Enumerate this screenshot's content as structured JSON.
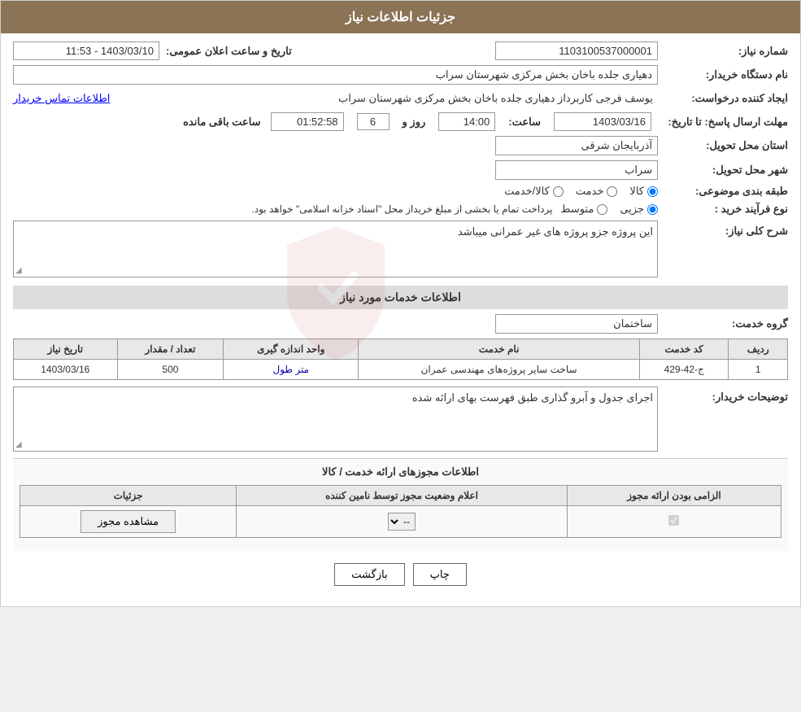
{
  "page": {
    "title": "جزئیات اطلاعات نیاز"
  },
  "header": {
    "need_number_label": "شماره نیاز:",
    "need_number_value": "1103100537000001",
    "date_label": "تاریخ و ساعت اعلان عمومی:",
    "date_value": "1403/03/10 - 11:53",
    "buyer_system_label": "نام دستگاه خریدار:",
    "buyer_system_value": "دهیاری جلده باخان بخش مرکزی شهرستان سراب",
    "creator_label": "ایجاد کننده درخواست:",
    "creator_value": "یوسف فرجی کاربرداز دهیاری جلده باخان بخش مرکزی شهرستان سراب",
    "contact_link": "اطلاعات تماس خریدار",
    "deadline_label": "مهلت ارسال پاسخ: تا تاریخ:",
    "deadline_date": "1403/03/16",
    "deadline_time_label": "ساعت:",
    "deadline_time": "14:00",
    "deadline_days_label": "روز و",
    "deadline_days": "6",
    "remaining_label": "ساعت باقی مانده",
    "remaining_time": "01:52:58",
    "province_label": "استان محل تحویل:",
    "province_value": "آذربایجان شرقی",
    "city_label": "شهر محل تحویل:",
    "city_value": "سراب",
    "category_label": "طبقه بندی موضوعی:",
    "category_options": [
      {
        "label": "کالا",
        "value": "kala"
      },
      {
        "label": "خدمت",
        "value": "khedmat"
      },
      {
        "label": "کالا/خدمت",
        "value": "kala_khedmat"
      }
    ],
    "category_selected": "kala",
    "purchase_type_label": "نوع فرآیند خرید :",
    "purchase_type_options": [
      {
        "label": "جزیی",
        "value": "jozi"
      },
      {
        "label": "متوسط",
        "value": "motavset"
      }
    ],
    "purchase_type_selected": "jozi",
    "purchase_type_note": "پرداخت تمام یا بخشی از مبلغ خریداز محل \"اسناد خزانه اسلامی\" خواهد بود.",
    "description_label": "شرح کلی نیاز:",
    "description_value": "این پروژه جزو پروژه های غیر عمرانی میباشد"
  },
  "services_section": {
    "title": "اطلاعات خدمات مورد نیاز",
    "service_group_label": "گروه خدمت:",
    "service_group_value": "ساختمان",
    "table": {
      "columns": [
        {
          "key": "row",
          "label": "ردیف"
        },
        {
          "key": "code",
          "label": "کد خدمت"
        },
        {
          "key": "name",
          "label": "نام خدمت"
        },
        {
          "key": "unit",
          "label": "واحد اندازه گیری"
        },
        {
          "key": "quantity",
          "label": "تعداد / مقدار"
        },
        {
          "key": "date",
          "label": "تاریخ نیاز"
        }
      ],
      "rows": [
        {
          "row": "1",
          "code": "ج-42-429",
          "name": "ساخت سایر پروژه‌های مهندسی عمران",
          "unit": "متر طول",
          "quantity": "500",
          "date": "1403/03/16"
        }
      ]
    },
    "buyer_desc_label": "توضیحات خریدار:",
    "buyer_desc_value": "اجرای جدول و آبرو گذاری طبق فهرست بهای ارائه شده"
  },
  "permissions_section": {
    "title": "اطلاعات مجوزهای ارائه خدمت / کالا",
    "table": {
      "columns": [
        {
          "key": "required",
          "label": "الزامی بودن ارائه مجوز"
        },
        {
          "key": "status",
          "label": "اعلام وضعیت مجوز توسط نامین کننده"
        },
        {
          "key": "details",
          "label": "جزئیات"
        }
      ],
      "rows": [
        {
          "required": true,
          "status": "--",
          "details_btn": "مشاهده مجوز"
        }
      ]
    }
  },
  "footer": {
    "print_btn": "چاپ",
    "back_btn": "بازگشت"
  }
}
